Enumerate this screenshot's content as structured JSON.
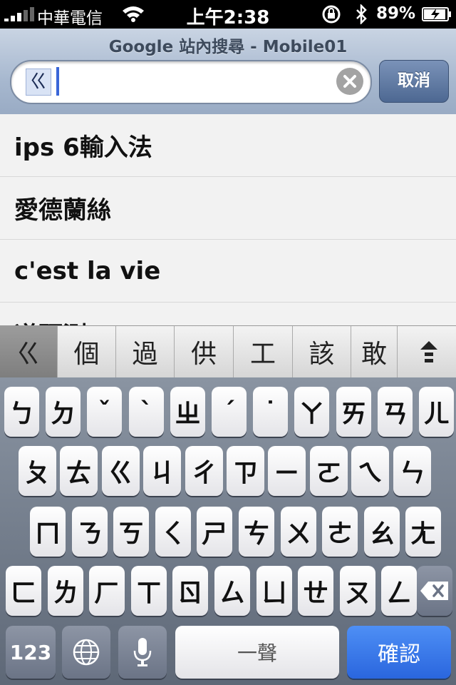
{
  "status": {
    "carrier": "中華電信",
    "time": "上午2:38",
    "battery_percent": "89%",
    "icons": [
      "signal-bars-icon",
      "wifi-icon",
      "rotation-lock-icon",
      "bluetooth-icon",
      "battery-charging-icon"
    ]
  },
  "header": {
    "title": "Google 站內搜尋 - Mobile01",
    "search_value": "ㄍ",
    "cancel_label": "取消"
  },
  "suggestions": [
    "ips 6輸入法",
    "愛德蘭絲",
    "c'est la vie",
    "道預測"
  ],
  "candidates": {
    "items": [
      "ㄍ",
      "個",
      "過",
      "供",
      "工",
      "該",
      "敢"
    ],
    "selected_index": 0
  },
  "keyboard": {
    "row1": [
      "ㄅ",
      "ㄉ",
      "ˇ",
      "ˋ",
      "ㄓ",
      "ˊ",
      "˙",
      "ㄚ",
      "ㄞ",
      "ㄢ",
      "ㄦ"
    ],
    "row2": [
      "ㄆ",
      "ㄊ",
      "ㄍ",
      "ㄐ",
      "ㄔ",
      "ㄗ",
      "ㄧ",
      "ㄛ",
      "ㄟ",
      "ㄣ"
    ],
    "row3": [
      "ㄇ",
      "ㄋ",
      "ㄎ",
      "ㄑ",
      "ㄕ",
      "ㄘ",
      "ㄨ",
      "ㄜ",
      "ㄠ",
      "ㄤ"
    ],
    "row4": [
      "ㄈ",
      "ㄌ",
      "ㄏ",
      "ㄒ",
      "ㄖ",
      "ㄙ",
      "ㄩ",
      "ㄝ",
      "ㄡ",
      "ㄥ"
    ],
    "numbers_label": "123",
    "space_label": "一聲",
    "enter_label": "確認"
  }
}
